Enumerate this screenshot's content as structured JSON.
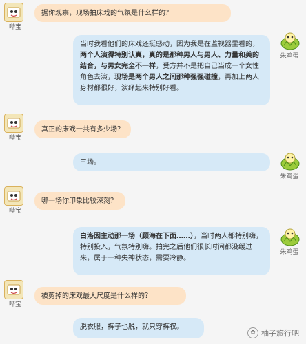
{
  "chat": {
    "messages": [
      {
        "side": "left",
        "name": "哔宝",
        "text": "据你观察，现场拍床戏的气氛是什么样的？"
      },
      {
        "side": "right",
        "name": "朱鸡蛋",
        "parts": [
          {
            "t": "当时我看他们的床戏还挺感动，因为我是在监视器里看的，"
          },
          {
            "b": "两个人演得特别认真，真的是那种男人与男人、力量和美的结合，与男女完全不一样"
          },
          {
            "t": "，受方并不是把自己当成一个女性角色去演，"
          },
          {
            "b": "现场是两个男人之间那种强强碰撞"
          },
          {
            "t": "，再加上两人身材都很好，演绎起来特别好看。"
          }
        ]
      },
      {
        "side": "left",
        "name": "哔宝",
        "text": "真正的床戏一共有多少场？"
      },
      {
        "side": "right",
        "name": "朱鸡蛋",
        "text": "三场。"
      },
      {
        "side": "left",
        "name": "哔宝",
        "text": "哪一场你印象比较深刻？"
      },
      {
        "side": "right",
        "name": "朱鸡蛋",
        "parts": [
          {
            "b": "白洛因主动那一场（顾海在下面……）"
          },
          {
            "t": "，当时两人都特别嗨，特别投入，气氛特别嗨。拍完之后他们很长时间都没缓过来，属于一种失神状态，需要冷静。"
          }
        ]
      },
      {
        "side": "left",
        "name": "哔宝",
        "text": "被剪掉的床戏最大尺度是什么样的？"
      },
      {
        "side": "right",
        "name": "朱鸡蛋",
        "text": "脱衣服，裤子也脱，就只穿裤衩。"
      }
    ]
  },
  "watermark": {
    "text": "柚子旅行吧"
  },
  "colors": {
    "left_bubble": "#fde3c7",
    "right_bubble": "#d6e9f7",
    "page_bg": "#f5f5f5"
  }
}
